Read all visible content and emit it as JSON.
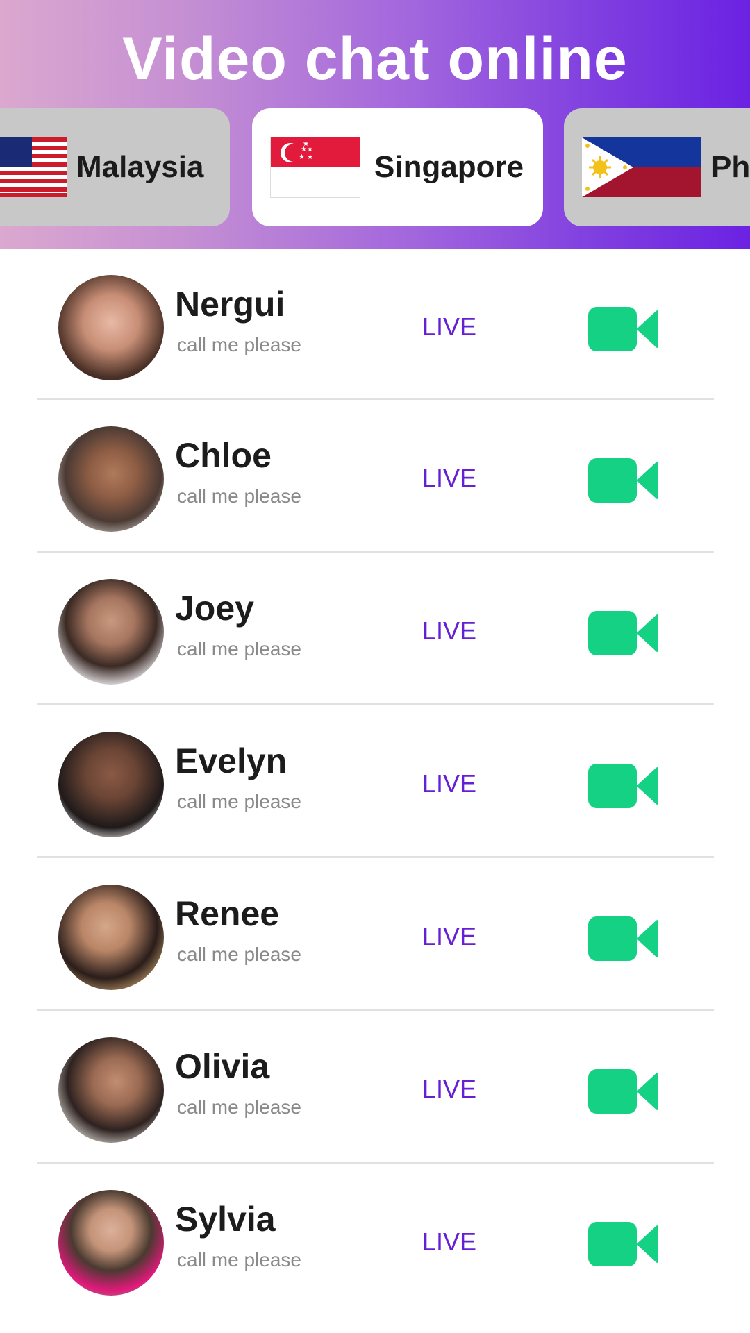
{
  "header": {
    "title": "Video chat online",
    "gradient": [
      "#dba8cf",
      "#6b22e2"
    ]
  },
  "country_tabs": [
    {
      "label": "Malaysia",
      "flag_icon": "malaysia-flag-icon",
      "selected": false
    },
    {
      "label": "Singapore",
      "flag_icon": "singapore-flag-icon",
      "selected": true
    },
    {
      "label": "Ph",
      "flag_icon": "philippines-flag-icon",
      "selected": false
    }
  ],
  "users": [
    {
      "name": "Nergui",
      "subtitle": "call me please",
      "status": "LIVE"
    },
    {
      "name": "Chloe",
      "subtitle": "call me please",
      "status": "LIVE"
    },
    {
      "name": "Joey",
      "subtitle": "call me please",
      "status": "LIVE"
    },
    {
      "name": "Evelyn",
      "subtitle": "call me please",
      "status": "LIVE"
    },
    {
      "name": "Renee",
      "subtitle": "call me please",
      "status": "LIVE"
    },
    {
      "name": "Olivia",
      "subtitle": "call me please",
      "status": "LIVE"
    },
    {
      "name": "Sylvia",
      "subtitle": "call me please",
      "status": "LIVE"
    }
  ],
  "colors": {
    "live_text": "#6520d6",
    "video_button": "#14d184",
    "tab_inactive": "#c8c8c8",
    "tab_active": "#ffffff"
  },
  "icons": {
    "call_button": "video-camera-icon",
    "avatar": "avatar-photo"
  }
}
